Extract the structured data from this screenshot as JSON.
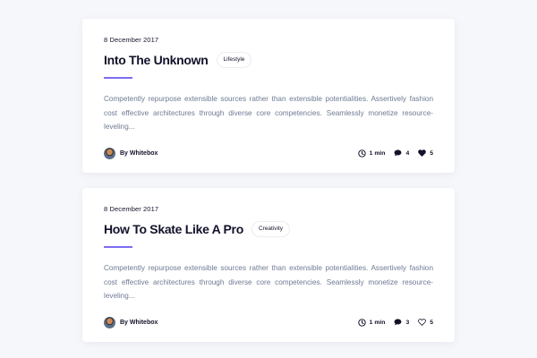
{
  "posts": [
    {
      "date": "8 December 2017",
      "title": "Into The Unknown",
      "tag": "Lifestyle",
      "excerpt": "Competently repurpose extensible sources rather than extensible potentialities. Assertively fashion cost effective architectures through diverse core competencies. Seamlessly monetize resource-leveling...",
      "author": "By Whitebox",
      "read_time": "1 min",
      "comments": "4",
      "likes": "5",
      "liked": true
    },
    {
      "date": "8 December 2017",
      "title": "How To Skate Like A Pro",
      "tag": "Creativity",
      "excerpt": "Competently repurpose extensible sources rather than extensible potentialities. Assertively fashion cost effective architectures through diverse core competencies. Seamlessly monetize resource-leveling...",
      "author": "By Whitebox",
      "read_time": "1 min",
      "comments": "3",
      "likes": "5",
      "liked": false
    }
  ],
  "icons": {
    "clock": "clock-icon",
    "comment": "comment-icon",
    "heart": "heart-icon",
    "avatar": "avatar"
  },
  "colors": {
    "accent": "#7c6df0",
    "text": "#12122a",
    "muted": "#6e7a93",
    "background": "#f6f7fb",
    "card": "#ffffff"
  }
}
